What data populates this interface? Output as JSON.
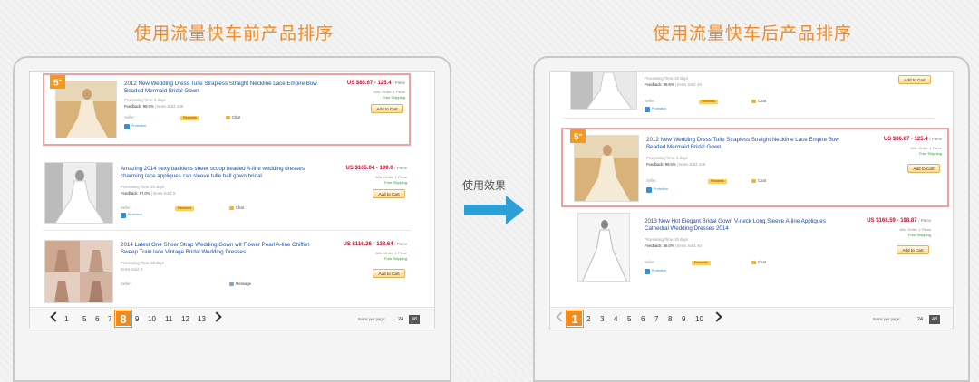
{
  "headings": {
    "before": "使用流量快车前产品排序",
    "after": "使用流量快车后产品排序",
    "arrow_label": "使用效果"
  },
  "colors": {
    "accent": "#f08a24",
    "arrow": "#2c9fd6",
    "price": "#c8102e",
    "link": "#1a4fa8"
  },
  "left": {
    "products": [
      {
        "ribbon": "5",
        "ribbon_sup": "th",
        "title": "2012 New Wedding Dress Tulle Strapless Straight Neckline Lace Empire Bow Beaded Mermaid Bridal Gown",
        "processing": "Processing Time: 5 days",
        "feedback_label": "Feedback:",
        "feedback": "99.0%",
        "sold": "| Items Sold: 449",
        "price": "US $86.67 - 125.4",
        "unit": "/ Piece",
        "min_order": "Min. Order: 1 Piece",
        "shipping": "Free Shipping",
        "cart": "Add to Cart",
        "seller": "Seller:",
        "seller_badge": "Rewards",
        "chat": "Chat",
        "protection": "Protection"
      },
      {
        "title": "Amazing 2014 sexy backless sheer scoop beaded A-line wedding dresses charming lace appliques cap sleeve tulle ball gown bridal",
        "processing": "Processing Time: 20 days",
        "feedback_label": "Feedback:",
        "feedback": "97.0%",
        "sold": "| Items Sold: 8",
        "price": "US $165.04 - 199.0",
        "unit": "/ Piece",
        "min_order": "Min. Order: 1 Piece",
        "shipping": "Free Shipping",
        "cart": "Add to Cart",
        "seller": "Seller:",
        "seller_badge": "Rewards",
        "chat": "Chat",
        "protection": "Protection"
      },
      {
        "title": "2014 Latest One Shoer Strap Wedding Gown wit Flower Pearl A-line Chiffon Sweep Train lace Vintage Bridal Wedding Dresses",
        "processing": "Processing Time: 20 days",
        "feedback_label": "",
        "feedback": "",
        "sold": "Items Sold: 5",
        "price": "US $116.26 - 138.64",
        "unit": "/ Piece",
        "min_order": "Min. Order: 1 Piece",
        "shipping": "Free Shipping",
        "cart": "Add to Cart",
        "seller": "Seller:",
        "seller_badge": "",
        "chat": "Message",
        "protection": ""
      }
    ],
    "pager": {
      "pages": [
        "1",
        "5",
        "6",
        "7",
        "8",
        "9",
        "10",
        "11",
        "12",
        "13"
      ],
      "current": "8",
      "items_per_page": "Items per page:",
      "ipp_options": [
        "24",
        "48"
      ]
    }
  },
  "right": {
    "products": [
      {
        "processing": "Processing Time: 20 days",
        "feedback_label": "Feedback:",
        "feedback": "99.5%",
        "sold": "| Items Sold: 46",
        "cart": "Add to Cart",
        "seller": "Seller:",
        "seller_badge": "Rewards",
        "chat": "Chat",
        "protection": "Protection"
      },
      {
        "ribbon": "5",
        "ribbon_sup": "th",
        "title": "2012 New Wedding Dress Tulle Strapless Straight Neckline Lace Empire Bow Beaded Mermaid Bridal Gown",
        "processing": "Processing Time: 5 days",
        "feedback_label": "Feedback:",
        "feedback": "99.5%",
        "sold": "| Items Sold: 449",
        "price": "US $86.67 - 125.4",
        "unit": "/ Piece",
        "min_order": "Min. Order: 1 Piece",
        "shipping": "Free Shipping",
        "cart": "Add to Cart",
        "seller": "Seller:",
        "seller_badge": "Rewards",
        "chat": "Chat",
        "protection": "Protection"
      },
      {
        "title": "2013 New Hot Elegant Bridal Gown V-neck Long Sleeve A-line Appliques Cathedral Wedding Dresses 2014",
        "processing": "Processing Time: 20 days",
        "feedback_label": "Feedback:",
        "feedback": "98.0%",
        "sold": "| Items Sold: 40",
        "price": "US $168.59 - 198.87",
        "unit": "/ Piece",
        "min_order": "Min. Order: 1 Piece",
        "shipping": "Free Shipping",
        "cart": "Add to Cart",
        "seller": "Seller:",
        "seller_badge": "Rewards",
        "chat": "Chat",
        "protection": "Protection"
      }
    ],
    "pager": {
      "pages": [
        "1",
        "2",
        "3",
        "4",
        "5",
        "6",
        "7",
        "8",
        "9",
        "10"
      ],
      "current": "1",
      "items_per_page": "Items per page:",
      "ipp_options": [
        "24",
        "48"
      ]
    }
  }
}
